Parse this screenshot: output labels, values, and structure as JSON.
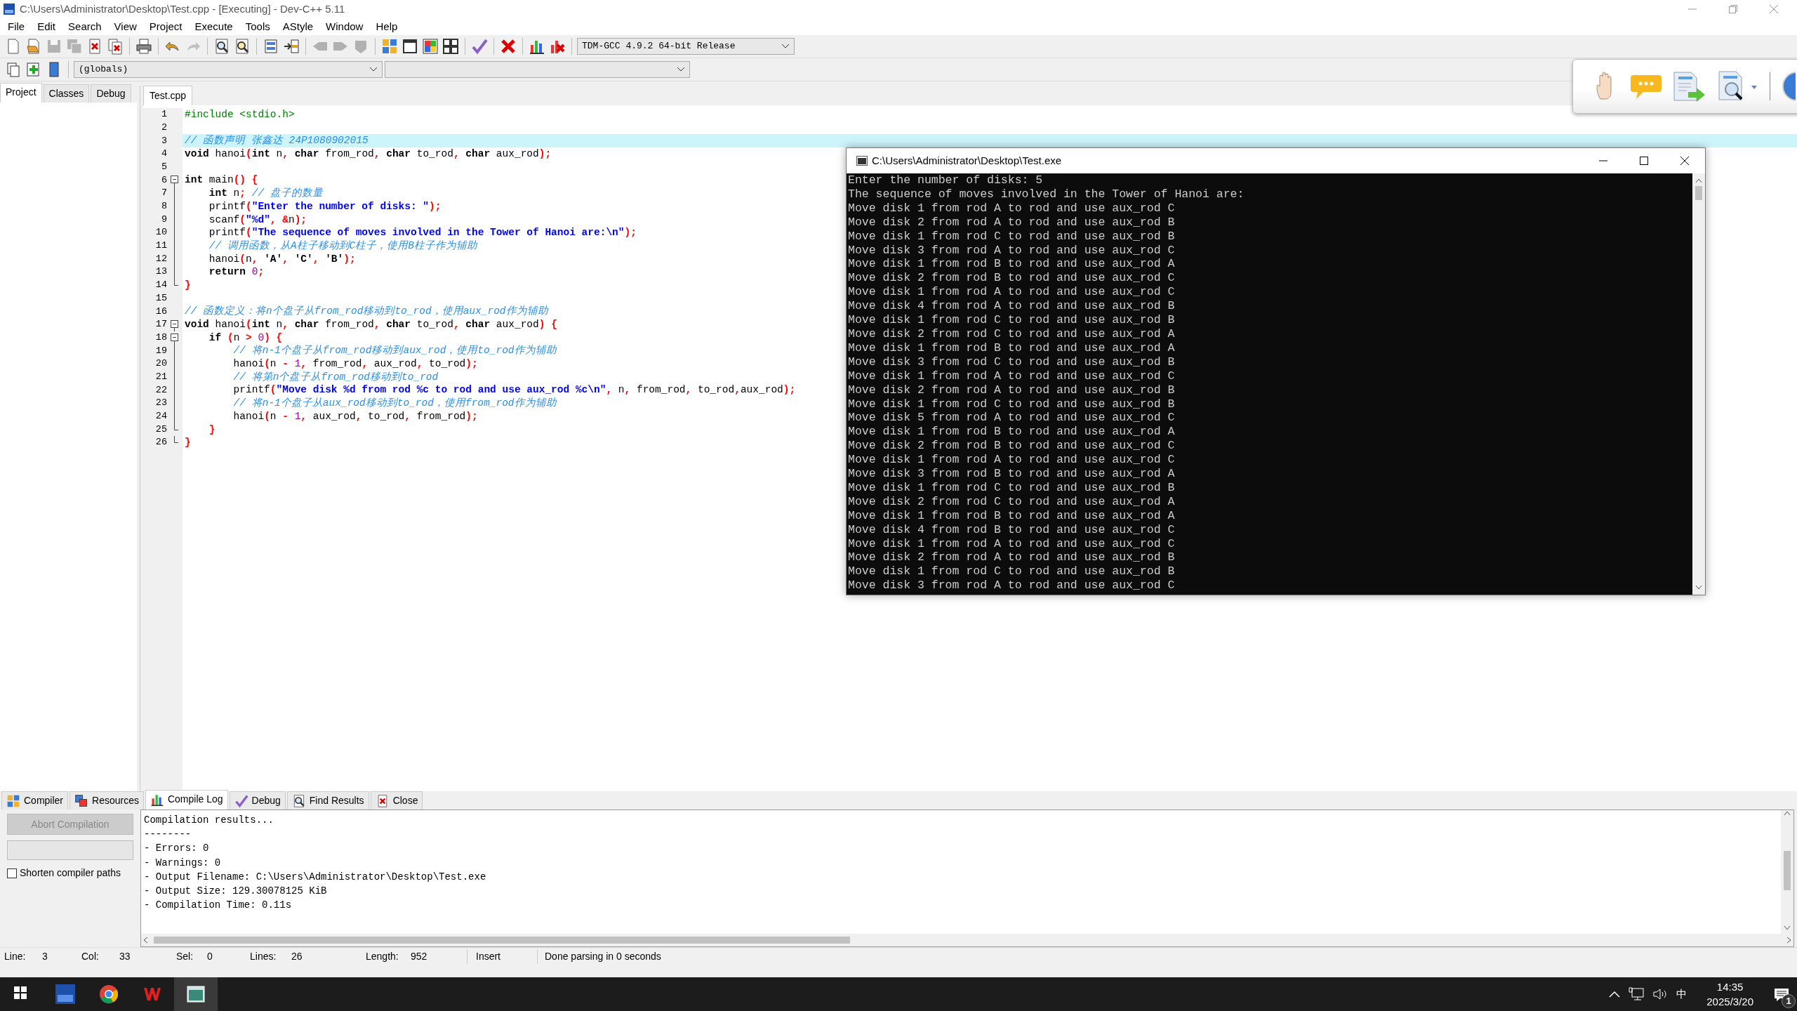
{
  "window": {
    "title": "C:\\Users\\Administrator\\Desktop\\Test.cpp - [Executing] - Dev-C++ 5.11"
  },
  "menu": [
    "File",
    "Edit",
    "Search",
    "View",
    "Project",
    "Execute",
    "Tools",
    "AStyle",
    "Window",
    "Help"
  ],
  "toolbar_1": {
    "buttons": [
      {
        "disabled": false
      },
      {
        "disabled": false
      },
      {
        "disabled": true
      },
      {
        "disabled": true
      },
      {
        "disabled": false
      },
      {
        "disabled": false
      },
      {
        "disabled": false
      },
      {
        "disabled": false
      },
      {
        "disabled": true
      },
      {
        "disabled": false
      },
      {
        "disabled": false
      },
      {
        "disabled": false
      },
      {
        "disabled": false
      },
      {
        "disabled": true
      },
      {
        "disabled": true
      },
      {
        "disabled": true
      },
      {
        "disabled": false
      },
      {
        "disabled": false
      },
      {
        "disabled": false
      },
      {
        "disabled": false
      },
      {
        "disabled": false
      },
      {
        "disabled": false
      },
      {
        "disabled": false
      },
      {
        "disabled": false
      }
    ],
    "compiler": "TDM-GCC 4.9.2 64-bit Release"
  },
  "toolbar_2": {
    "scope": "(globals)"
  },
  "side_tabs": [
    {
      "label": "Project",
      "selected": true
    },
    {
      "label": "Classes",
      "selected": false
    },
    {
      "label": "Debug",
      "selected": false
    }
  ],
  "editor": {
    "tabs": [
      {
        "label": "Test.cpp",
        "selected": true
      }
    ],
    "lines": [
      {
        "number": "1",
        "tokens": [
          {
            "kind": "preproc",
            "text": "#include <stdio.h>"
          }
        ]
      },
      {
        "number": "2"
      },
      {
        "number": "3",
        "current": true,
        "tokens": [
          {
            "kind": "comment",
            "text": "// 函数声明 张鑫达 24P1080902015"
          }
        ]
      },
      {
        "number": "4",
        "tokens": [
          {
            "kind": "keyword",
            "text": "void"
          },
          {
            "kind": "id",
            "text": " hanoi"
          },
          {
            "kind": "symbol",
            "text": "("
          },
          {
            "kind": "keyword",
            "text": "int"
          },
          {
            "kind": "id",
            "text": " n"
          },
          {
            "kind": "symbol",
            "text": ","
          },
          {
            "kind": "keyword",
            "text": " char"
          },
          {
            "kind": "id",
            "text": " from_rod"
          },
          {
            "kind": "symbol",
            "text": ","
          },
          {
            "kind": "keyword",
            "text": " char"
          },
          {
            "kind": "id",
            "text": " to_rod"
          },
          {
            "kind": "symbol",
            "text": ","
          },
          {
            "kind": "keyword",
            "text": " char"
          },
          {
            "kind": "id",
            "text": " aux_rod"
          },
          {
            "kind": "symbol",
            "text": ");"
          }
        ]
      },
      {
        "number": "5"
      },
      {
        "number": "6",
        "kind": "fold_start",
        "expanded": true,
        "tokens": [
          {
            "kind": "keyword",
            "text": "int"
          },
          {
            "kind": "id",
            "text": " main"
          },
          {
            "kind": "symbol",
            "text": "() {"
          }
        ]
      },
      {
        "number": "7",
        "kind": "fold_body",
        "tokens": [
          {
            "kind": "keyword",
            "text": "    int"
          },
          {
            "kind": "id",
            "text": " n"
          },
          {
            "kind": "symbol",
            "text": ";"
          },
          {
            "kind": "comment",
            "text": " // 盘子的数量"
          }
        ]
      },
      {
        "number": "8",
        "kind": "fold_body",
        "tokens": [
          {
            "kind": "id",
            "text": "    printf"
          },
          {
            "kind": "symbol",
            "text": "("
          },
          {
            "kind": "string",
            "text": "\"Enter the number of disks: \""
          },
          {
            "kind": "symbol",
            "text": ");"
          }
        ]
      },
      {
        "number": "9",
        "kind": "fold_body",
        "tokens": [
          {
            "kind": "id",
            "text": "    scanf"
          },
          {
            "kind": "symbol",
            "text": "("
          },
          {
            "kind": "string",
            "text": "\"%d\""
          },
          {
            "kind": "symbol",
            "text": ", &"
          },
          {
            "kind": "id",
            "text": "n"
          },
          {
            "kind": "symbol",
            "text": ");"
          }
        ]
      },
      {
        "number": "10",
        "kind": "fold_body",
        "tokens": [
          {
            "kind": "id",
            "text": "    printf"
          },
          {
            "kind": "symbol",
            "text": "("
          },
          {
            "kind": "string",
            "text": "\"The sequence of moves involved in the Tower of Hanoi are:\\n\""
          },
          {
            "kind": "symbol",
            "text": ");"
          }
        ]
      },
      {
        "number": "11",
        "kind": "fold_body",
        "tokens": [
          {
            "kind": "comment",
            "text": "    // 调用函数，从A柱子移动到C柱子，使用B柱子作为辅助"
          }
        ]
      },
      {
        "number": "12",
        "kind": "fold_body",
        "tokens": [
          {
            "kind": "id",
            "text": "    hanoi"
          },
          {
            "kind": "symbol",
            "text": "("
          },
          {
            "kind": "id",
            "text": "n"
          },
          {
            "kind": "symbol",
            "text": ", "
          },
          {
            "kind": "char",
            "text": "'A'"
          },
          {
            "kind": "symbol",
            "text": ", "
          },
          {
            "kind": "char",
            "text": "'C'"
          },
          {
            "kind": "symbol",
            "text": ", "
          },
          {
            "kind": "char",
            "text": "'B'"
          },
          {
            "kind": "symbol",
            "text": ");"
          }
        ]
      },
      {
        "number": "13",
        "kind": "fold_body",
        "tokens": [
          {
            "kind": "keyword",
            "text": "    return"
          },
          {
            "kind": "number",
            "text": " 0"
          },
          {
            "kind": "symbol",
            "text": ";"
          }
        ]
      },
      {
        "number": "14",
        "kind": "fold_end",
        "tokens": [
          {
            "kind": "symbol",
            "text": "}"
          }
        ]
      },
      {
        "number": "15"
      },
      {
        "number": "16",
        "tokens": [
          {
            "kind": "comment",
            "text": "// 函数定义：将n个盘子从from_rod移动到to_rod，使用aux_rod作为辅助"
          }
        ]
      },
      {
        "number": "17",
        "kind": "fold_start",
        "expanded": true,
        "tokens": [
          {
            "kind": "keyword",
            "text": "void"
          },
          {
            "kind": "id",
            "text": " hanoi"
          },
          {
            "kind": "symbol",
            "text": "("
          },
          {
            "kind": "keyword",
            "text": "int"
          },
          {
            "kind": "id",
            "text": " n"
          },
          {
            "kind": "symbol",
            "text": ","
          },
          {
            "kind": "keyword",
            "text": " char"
          },
          {
            "kind": "id",
            "text": " from_rod"
          },
          {
            "kind": "symbol",
            "text": ","
          },
          {
            "kind": "keyword",
            "text": " char"
          },
          {
            "kind": "id",
            "text": " to_rod"
          },
          {
            "kind": "symbol",
            "text": ","
          },
          {
            "kind": "keyword",
            "text": " char"
          },
          {
            "kind": "id",
            "text": " aux_rod"
          },
          {
            "kind": "symbol",
            "text": ") {"
          }
        ]
      },
      {
        "number": "18",
        "kind": "fold_start",
        "expanded": true,
        "tokens": [
          {
            "kind": "keyword",
            "text": "    if"
          },
          {
            "kind": "symbol",
            "text": " ("
          },
          {
            "kind": "id",
            "text": "n "
          },
          {
            "kind": "symbol",
            "text": ">"
          },
          {
            "kind": "number",
            "text": " 0"
          },
          {
            "kind": "symbol",
            "text": ") {"
          }
        ]
      },
      {
        "number": "19",
        "kind": "fold_body",
        "tokens": [
          {
            "kind": "comment",
            "text": "        // 将n-1个盘子从from_rod移动到aux_rod，使用to_rod作为辅助"
          }
        ]
      },
      {
        "number": "20",
        "kind": "fold_body",
        "tokens": [
          {
            "kind": "id",
            "text": "        hanoi"
          },
          {
            "kind": "symbol",
            "text": "("
          },
          {
            "kind": "id",
            "text": "n "
          },
          {
            "kind": "symbol",
            "text": "-"
          },
          {
            "kind": "number",
            "text": " 1"
          },
          {
            "kind": "symbol",
            "text": ","
          },
          {
            "kind": "id",
            "text": " from_rod"
          },
          {
            "kind": "symbol",
            "text": ","
          },
          {
            "kind": "id",
            "text": " aux_rod"
          },
          {
            "kind": "symbol",
            "text": ","
          },
          {
            "kind": "id",
            "text": " to_rod"
          },
          {
            "kind": "symbol",
            "text": ");"
          }
        ]
      },
      {
        "number": "21",
        "kind": "fold_body",
        "tokens": [
          {
            "kind": "comment",
            "text": "        // 将第n个盘子从from_rod移动到to_rod"
          }
        ]
      },
      {
        "number": "22",
        "kind": "fold_body",
        "tokens": [
          {
            "kind": "id",
            "text": "        printf"
          },
          {
            "kind": "symbol",
            "text": "("
          },
          {
            "kind": "string",
            "text": "\"Move disk %d from rod %c to rod and use aux_rod %c\\n\""
          },
          {
            "kind": "symbol",
            "text": ","
          },
          {
            "kind": "id",
            "text": " n"
          },
          {
            "kind": "symbol",
            "text": ","
          },
          {
            "kind": "id",
            "text": " from_rod"
          },
          {
            "kind": "symbol",
            "text": ","
          },
          {
            "kind": "id",
            "text": " to_rod"
          },
          {
            "kind": "symbol",
            "text": ","
          },
          {
            "kind": "id",
            "text": "aux_rod"
          },
          {
            "kind": "symbol",
            "text": ");"
          }
        ]
      },
      {
        "number": "23",
        "kind": "fold_body",
        "tokens": [
          {
            "kind": "comment",
            "text": "        // 将n-1个盘子从aux_rod移动到to_rod，使用from_rod作为辅助"
          }
        ]
      },
      {
        "number": "24",
        "kind": "fold_body",
        "tokens": [
          {
            "kind": "id",
            "text": "        hanoi"
          },
          {
            "kind": "symbol",
            "text": "("
          },
          {
            "kind": "id",
            "text": "n "
          },
          {
            "kind": "symbol",
            "text": "-"
          },
          {
            "kind": "number",
            "text": " 1"
          },
          {
            "kind": "symbol",
            "text": ","
          },
          {
            "kind": "id",
            "text": " aux_rod"
          },
          {
            "kind": "symbol",
            "text": ","
          },
          {
            "kind": "id",
            "text": " to_rod"
          },
          {
            "kind": "symbol",
            "text": ","
          },
          {
            "kind": "id",
            "text": " from_rod"
          },
          {
            "kind": "symbol",
            "text": ");"
          }
        ]
      },
      {
        "number": "25",
        "kind": "fold_end",
        "tokens": [
          {
            "kind": "symbol",
            "text": "    }"
          }
        ]
      },
      {
        "number": "26",
        "kind": "fold_end",
        "tokens": [
          {
            "kind": "symbol",
            "text": "}"
          }
        ]
      }
    ]
  },
  "console": {
    "title": "C:\\Users\\Administrator\\Desktop\\Test.exe",
    "lines": [
      "Enter the number of disks: 5",
      "The sequence of moves involved in the Tower of Hanoi are:",
      "Move disk 1 from rod A to rod and use aux_rod C",
      "Move disk 2 from rod A to rod and use aux_rod B",
      "Move disk 1 from rod C to rod and use aux_rod B",
      "Move disk 3 from rod A to rod and use aux_rod C",
      "Move disk 1 from rod B to rod and use aux_rod A",
      "Move disk 2 from rod B to rod and use aux_rod C",
      "Move disk 1 from rod A to rod and use aux_rod C",
      "Move disk 4 from rod A to rod and use aux_rod B",
      "Move disk 1 from rod C to rod and use aux_rod B",
      "Move disk 2 from rod C to rod and use aux_rod A",
      "Move disk 1 from rod B to rod and use aux_rod A",
      "Move disk 3 from rod C to rod and use aux_rod B",
      "Move disk 1 from rod A to rod and use aux_rod C",
      "Move disk 2 from rod A to rod and use aux_rod B",
      "Move disk 1 from rod C to rod and use aux_rod B",
      "Move disk 5 from rod A to rod and use aux_rod C",
      "Move disk 1 from rod B to rod and use aux_rod A",
      "Move disk 2 from rod B to rod and use aux_rod C",
      "Move disk 1 from rod A to rod and use aux_rod C",
      "Move disk 3 from rod B to rod and use aux_rod A",
      "Move disk 1 from rod C to rod and use aux_rod B",
      "Move disk 2 from rod C to rod and use aux_rod A",
      "Move disk 1 from rod B to rod and use aux_rod A",
      "Move disk 4 from rod B to rod and use aux_rod C",
      "Move disk 1 from rod A to rod and use aux_rod C",
      "Move disk 2 from rod A to rod and use aux_rod B",
      "Move disk 1 from rod C to rod and use aux_rod B",
      "Move disk 3 from rod A to rod and use aux_rod C"
    ]
  },
  "bottom_tabs": [
    {
      "label": "Compiler",
      "selected": false
    },
    {
      "label": "Resources",
      "selected": false
    },
    {
      "label": "Compile Log",
      "selected": true
    },
    {
      "label": "Debug",
      "selected": false
    },
    {
      "label": "Find Results",
      "selected": false
    },
    {
      "label": "Close",
      "selected": false
    }
  ],
  "compile_panel": {
    "abort_button": {
      "label": "Abort Compilation",
      "disabled": true
    },
    "progress": {
      "level": 0
    },
    "shorten_paths": {
      "label": "Shorten compiler paths",
      "checked": false
    },
    "log": [
      "Compilation results...",
      "--------",
      "- Errors: 0",
      "- Warnings: 0",
      "- Output Filename: C:\\Users\\Administrator\\Desktop\\Test.exe",
      "- Output Size: 129.30078125 KiB",
      "- Compilation Time: 0.11s"
    ]
  },
  "status_bar": [
    {
      "label": "Line:",
      "value": "3"
    },
    {
      "label": "Col:",
      "value": "33"
    },
    {
      "label": "Sel:",
      "value": "0"
    },
    {
      "label": "Lines:",
      "value": "26"
    },
    {
      "label": "Length:",
      "value": "952"
    }
  ],
  "status_mode": "Insert",
  "status_message": "Done parsing in 0 seconds",
  "taskbar": {
    "ime": "中",
    "time": "14:35",
    "date": "2025/3/20",
    "notifications": "1"
  }
}
